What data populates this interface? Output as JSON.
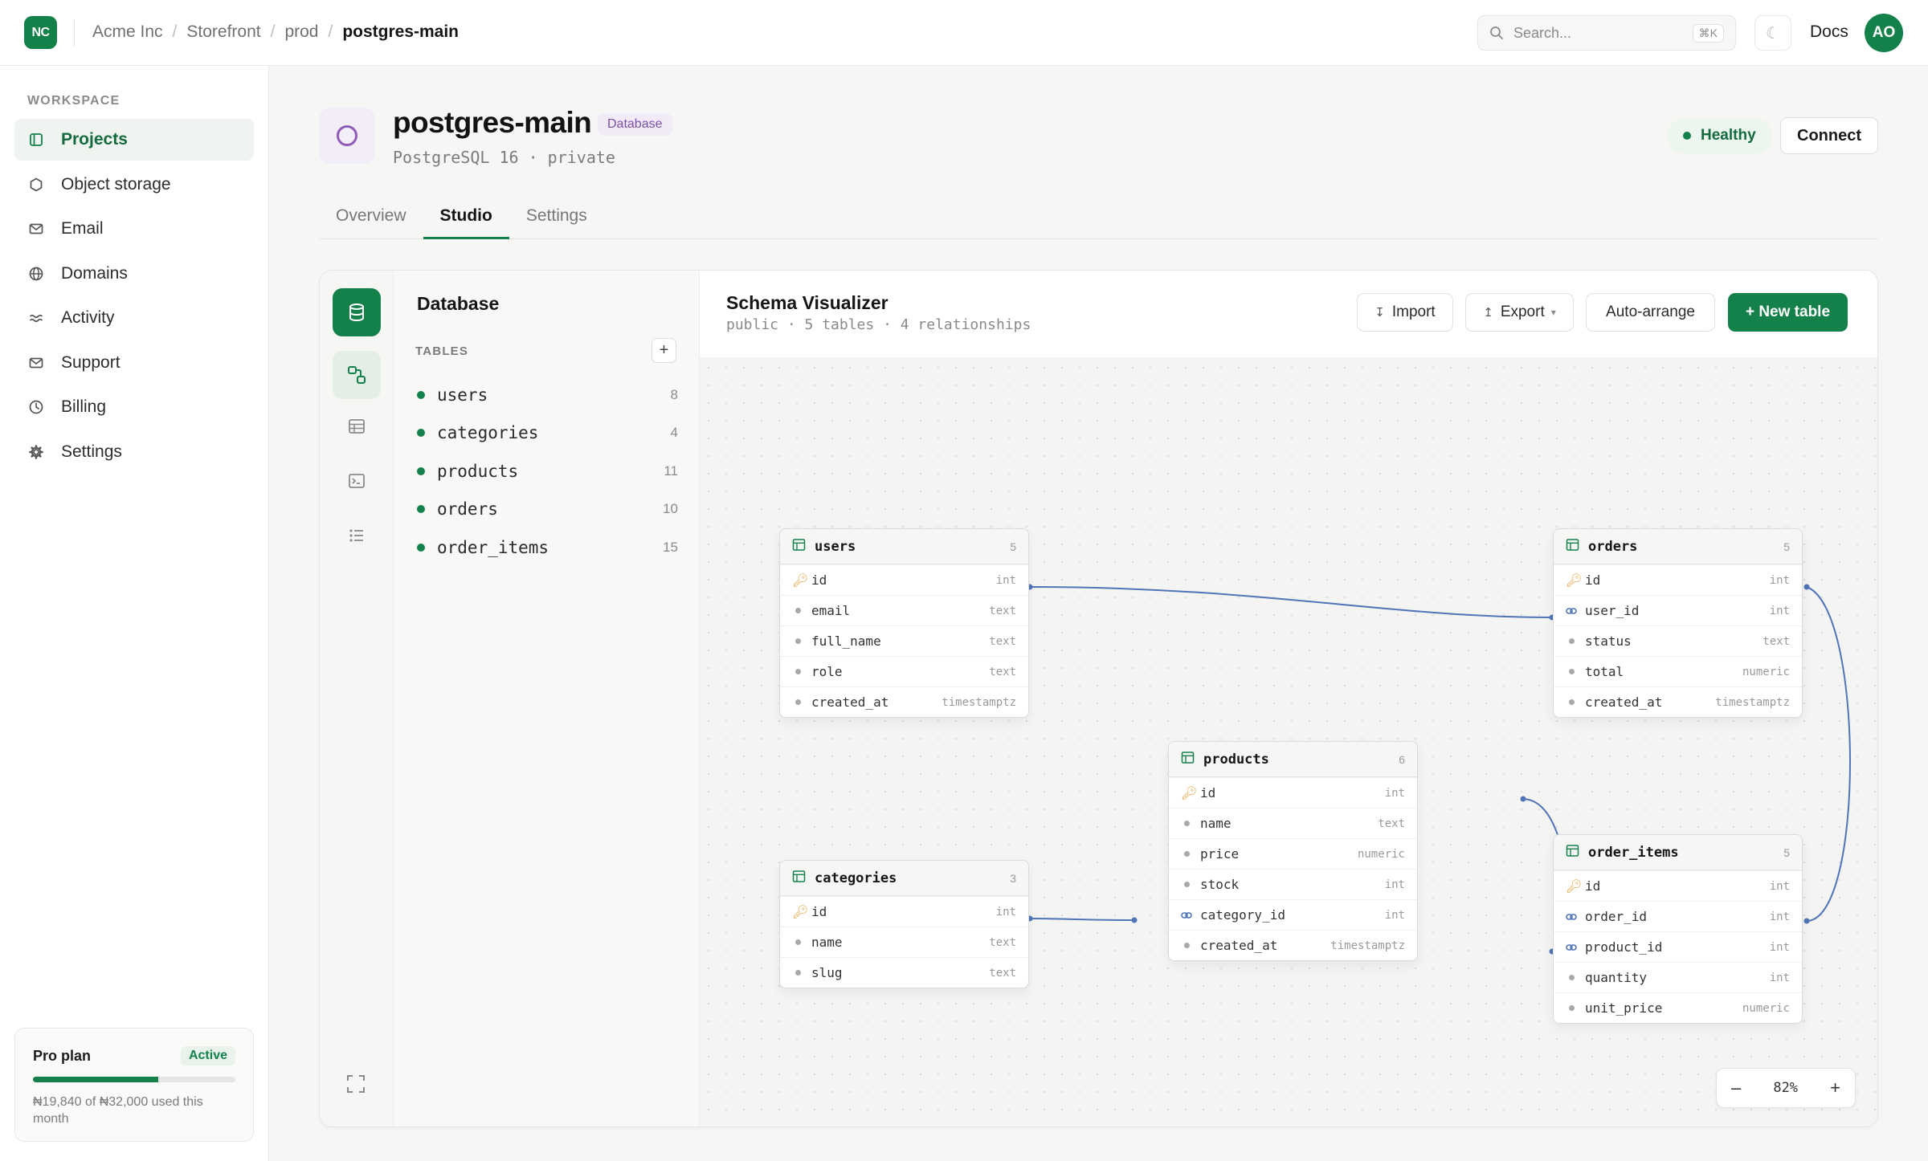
{
  "header": {
    "logo": "NC",
    "breadcrumb": [
      "Acme Inc",
      "Storefront",
      "prod",
      "postgres-main"
    ],
    "search_placeholder": "Search...",
    "search_shortcut": "⌘K",
    "theme_icon": "☾",
    "docs": "Docs",
    "avatar": "AO"
  },
  "sidebar": {
    "section_label": "WORKSPACE",
    "items": [
      {
        "label": "Projects",
        "icon": "projects-icon",
        "active": true
      },
      {
        "label": "Object storage",
        "icon": "hexagon-icon"
      },
      {
        "label": "Email",
        "icon": "mail-icon"
      },
      {
        "label": "Domains",
        "icon": "globe-icon"
      },
      {
        "label": "Activity",
        "icon": "activity-icon"
      },
      {
        "label": "Support",
        "icon": "mail-icon"
      },
      {
        "label": "Billing",
        "icon": "clock-icon"
      },
      {
        "label": "Settings",
        "icon": "gear-icon"
      }
    ],
    "plan": {
      "name": "Pro plan",
      "status": "Active",
      "usage_fraction": 0.62,
      "usage_text": "₦19,840 of ₦32,000 used this month"
    }
  },
  "page": {
    "title": "postgres-main",
    "badge": "Database",
    "subtitle": "PostgreSQL 16 · private",
    "status": "Healthy",
    "connect_label": "Connect",
    "tabs": [
      {
        "label": "Overview"
      },
      {
        "label": "Studio",
        "active": true
      },
      {
        "label": "Settings"
      }
    ]
  },
  "studio": {
    "panel_title": "Database",
    "tables_label": "TABLES",
    "add_glyph": "+",
    "tables": [
      {
        "name": "users",
        "count": "8"
      },
      {
        "name": "categories",
        "count": "4"
      },
      {
        "name": "products",
        "count": "11"
      },
      {
        "name": "orders",
        "count": "10"
      },
      {
        "name": "order_items",
        "count": "15"
      }
    ],
    "canvas": {
      "title": "Schema Visualizer",
      "subtitle": "public · 5 tables · 4 relationships",
      "import_label": "Import",
      "export_label": "Export",
      "autoarrange_label": "Auto-arrange",
      "new_table_label": "+ New table",
      "zoom": "82%",
      "zoom_out": "–",
      "zoom_in": "+"
    },
    "erd": {
      "users": {
        "name": "users",
        "count": "5",
        "columns": [
          {
            "name": "id",
            "type": "int",
            "kind": "pk"
          },
          {
            "name": "email",
            "type": "text",
            "kind": "col"
          },
          {
            "name": "full_name",
            "type": "text",
            "kind": "col"
          },
          {
            "name": "role",
            "type": "text",
            "kind": "col"
          },
          {
            "name": "created_at",
            "type": "timestamptz",
            "kind": "col"
          }
        ]
      },
      "orders": {
        "name": "orders",
        "count": "5",
        "columns": [
          {
            "name": "id",
            "type": "int",
            "kind": "pk"
          },
          {
            "name": "user_id",
            "type": "int",
            "kind": "fk"
          },
          {
            "name": "status",
            "type": "text",
            "kind": "col"
          },
          {
            "name": "total",
            "type": "numeric",
            "kind": "col"
          },
          {
            "name": "created_at",
            "type": "timestamptz",
            "kind": "col"
          }
        ]
      },
      "products": {
        "name": "products",
        "count": "6",
        "columns": [
          {
            "name": "id",
            "type": "int",
            "kind": "pk"
          },
          {
            "name": "name",
            "type": "text",
            "kind": "col"
          },
          {
            "name": "price",
            "type": "numeric",
            "kind": "col"
          },
          {
            "name": "stock",
            "type": "int",
            "kind": "col"
          },
          {
            "name": "category_id",
            "type": "int",
            "kind": "fk"
          },
          {
            "name": "created_at",
            "type": "timestamptz",
            "kind": "col"
          }
        ]
      },
      "categories": {
        "name": "categories",
        "count": "3",
        "columns": [
          {
            "name": "id",
            "type": "int",
            "kind": "pk"
          },
          {
            "name": "name",
            "type": "text",
            "kind": "col"
          },
          {
            "name": "slug",
            "type": "text",
            "kind": "col"
          }
        ]
      },
      "order_items": {
        "name": "order_items",
        "count": "5",
        "columns": [
          {
            "name": "id",
            "type": "int",
            "kind": "pk"
          },
          {
            "name": "order_id",
            "type": "int",
            "kind": "fk"
          },
          {
            "name": "product_id",
            "type": "int",
            "kind": "fk"
          },
          {
            "name": "quantity",
            "type": "int",
            "kind": "col"
          },
          {
            "name": "unit_price",
            "type": "numeric",
            "kind": "col"
          }
        ]
      }
    },
    "colors": {
      "accent": "#14804a",
      "relation": "#4f74b8",
      "key": "#e0a13b"
    }
  }
}
